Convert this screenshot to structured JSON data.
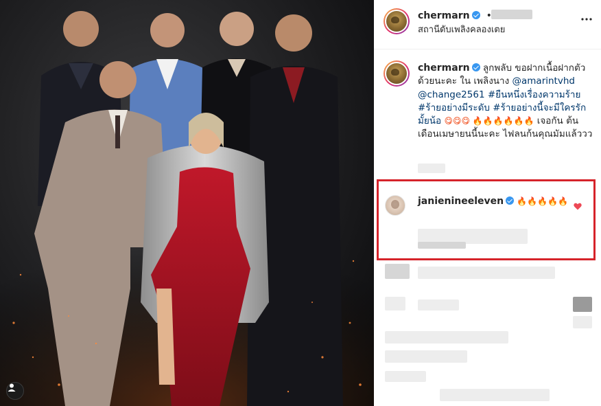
{
  "post": {
    "username": "chermarn",
    "header_separator": "•",
    "location": "สถานีดับเพลิงคลองเตย",
    "more_icon": "ellipsis-icon",
    "tag_icon": "person-tag-icon"
  },
  "caption": {
    "username": "chermarn",
    "text_before_mentions": "ลูกพลับ ขอฝากเนื้อฝากตัวด้วยนะคะ ใน เพลิงนาง",
    "mention_1": "@amarintvhd",
    "mention_2": "@change2561",
    "hashtag_1": "#ยืนหนึ่งเรื่องความร้าย",
    "hashtag_2": "#ร้ายอย่างมีระดับ",
    "hashtag_3": "#ร้ายอย่างนี้จะมีใครรักมั้ยน้อ",
    "emoji_line": "😋😋😋 🔥🔥🔥🔥🔥🔥",
    "text_after_emoji": "เจอกัน ต้นเดือนเมษายนนี้นะคะ ไฟลนก้นคุณมัมแล้ววว"
  },
  "comment": {
    "username": "janienineeleven",
    "text": "🔥🔥🔥🔥🔥",
    "like_icon": "heart-filled-icon",
    "like_color": "#ed4956"
  },
  "colors": {
    "highlight_border": "#d6232a",
    "verified_badge": "#3897f0",
    "mention_link": "#00376b"
  }
}
